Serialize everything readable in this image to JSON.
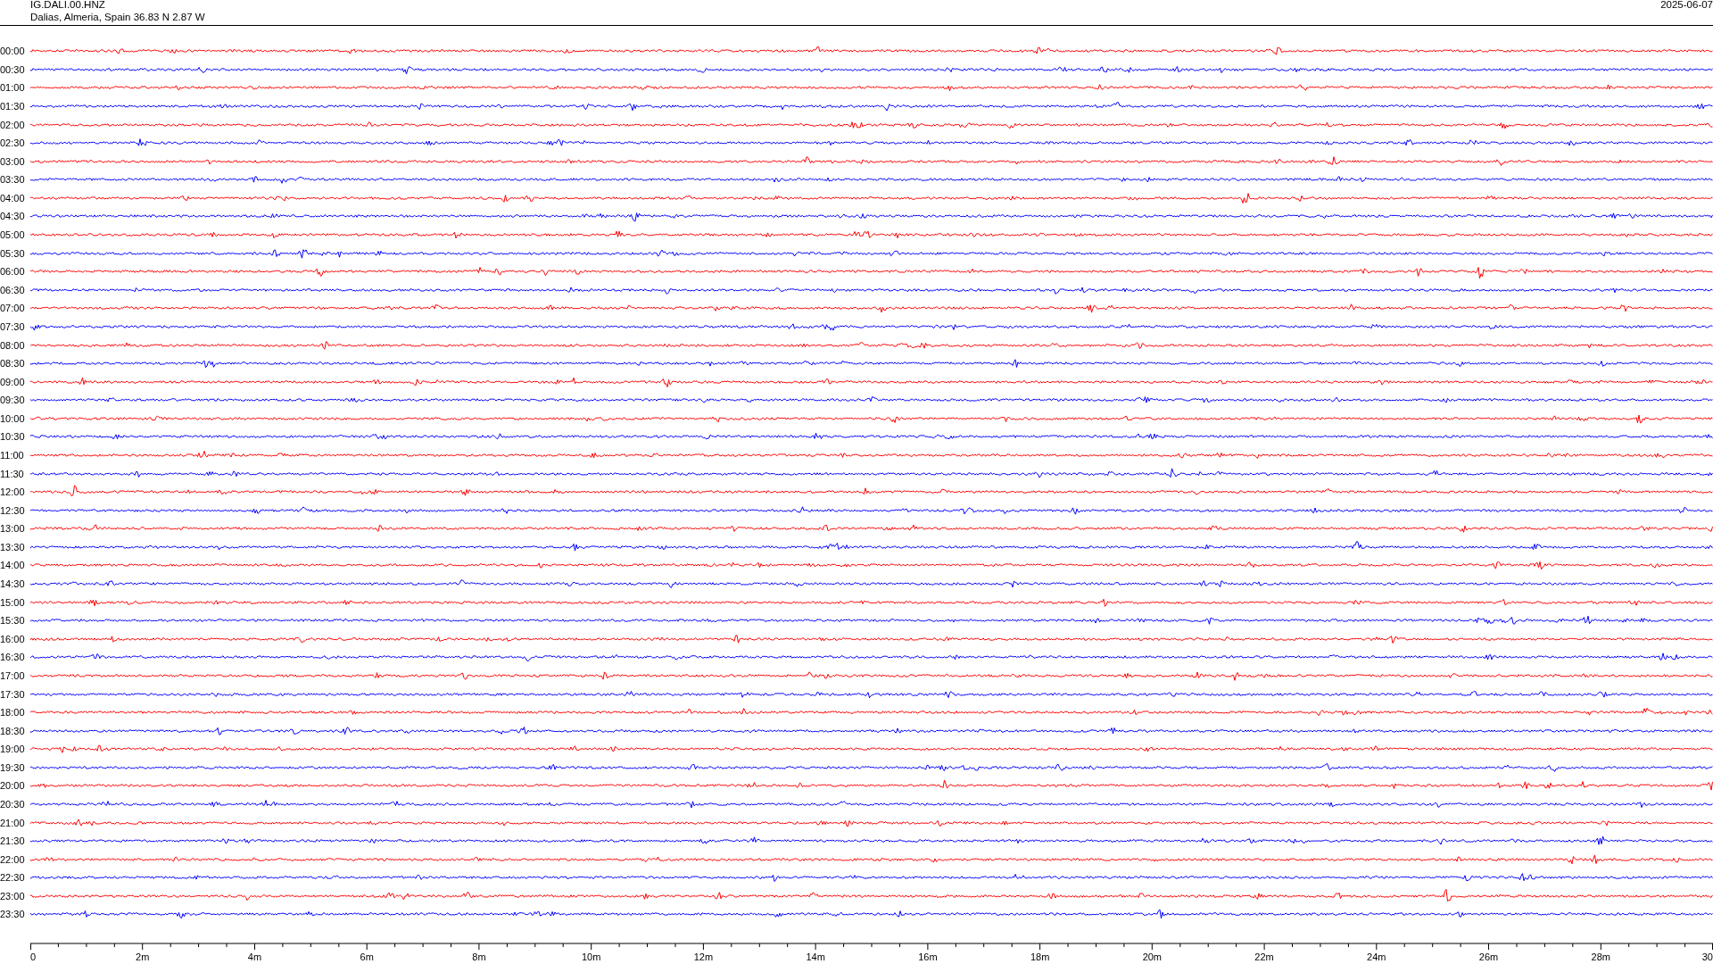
{
  "header": {
    "station": "IG.DALI.00.HNZ",
    "location": "Dalias, Almeria, Spain  36.83 N 2.87 W",
    "date": "2025-06-07"
  },
  "rows": [
    {
      "time": "00:00",
      "color": "#ff0000"
    },
    {
      "time": "00:30",
      "color": "#0000ff"
    },
    {
      "time": "01:00",
      "color": "#ff0000"
    },
    {
      "time": "01:30",
      "color": "#0000ff"
    },
    {
      "time": "02:00",
      "color": "#ff0000"
    },
    {
      "time": "02:30",
      "color": "#0000ff"
    },
    {
      "time": "03:00",
      "color": "#ff0000"
    },
    {
      "time": "03:30",
      "color": "#0000ff"
    },
    {
      "time": "04:00",
      "color": "#ff0000"
    },
    {
      "time": "04:30",
      "color": "#0000ff"
    },
    {
      "time": "05:00",
      "color": "#ff0000"
    },
    {
      "time": "05:30",
      "color": "#0000ff"
    },
    {
      "time": "06:00",
      "color": "#ff0000"
    },
    {
      "time": "06:30",
      "color": "#0000ff"
    },
    {
      "time": "07:00",
      "color": "#ff0000"
    },
    {
      "time": "07:30",
      "color": "#0000ff"
    },
    {
      "time": "08:00",
      "color": "#ff0000"
    },
    {
      "time": "08:30",
      "color": "#0000ff"
    },
    {
      "time": "09:00",
      "color": "#ff0000"
    },
    {
      "time": "09:30",
      "color": "#0000ff"
    },
    {
      "time": "10:00",
      "color": "#ff0000"
    },
    {
      "time": "10:30",
      "color": "#0000ff"
    },
    {
      "time": "11:00",
      "color": "#ff0000"
    },
    {
      "time": "11:30",
      "color": "#0000ff"
    },
    {
      "time": "12:00",
      "color": "#ff0000"
    },
    {
      "time": "12:30",
      "color": "#0000ff"
    },
    {
      "time": "13:00",
      "color": "#ff0000"
    },
    {
      "time": "13:30",
      "color": "#0000ff"
    },
    {
      "time": "14:00",
      "color": "#ff0000"
    },
    {
      "time": "14:30",
      "color": "#0000ff"
    },
    {
      "time": "15:00",
      "color": "#ff0000"
    },
    {
      "time": "15:30",
      "color": "#0000ff"
    },
    {
      "time": "16:00",
      "color": "#ff0000"
    },
    {
      "time": "16:30",
      "color": "#0000ff"
    },
    {
      "time": "17:00",
      "color": "#ff0000"
    },
    {
      "time": "17:30",
      "color": "#0000ff"
    },
    {
      "time": "18:00",
      "color": "#ff0000"
    },
    {
      "time": "18:30",
      "color": "#0000ff"
    },
    {
      "time": "19:00",
      "color": "#ff0000"
    },
    {
      "time": "19:30",
      "color": "#0000ff"
    },
    {
      "time": "20:00",
      "color": "#ff0000"
    },
    {
      "time": "20:30",
      "color": "#0000ff"
    },
    {
      "time": "21:00",
      "color": "#ff0000"
    },
    {
      "time": "21:30",
      "color": "#0000ff"
    },
    {
      "time": "22:00",
      "color": "#ff0000"
    },
    {
      "time": "22:30",
      "color": "#0000ff"
    },
    {
      "time": "23:00",
      "color": "#ff0000"
    },
    {
      "time": "23:30",
      "color": "#0000ff"
    }
  ],
  "axis": {
    "labels": [
      "0",
      "2m",
      "4m",
      "6m",
      "8m",
      "10m",
      "12m",
      "14m",
      "16m",
      "18m",
      "20m",
      "22m",
      "24m",
      "26m",
      "28m",
      "30"
    ]
  }
}
